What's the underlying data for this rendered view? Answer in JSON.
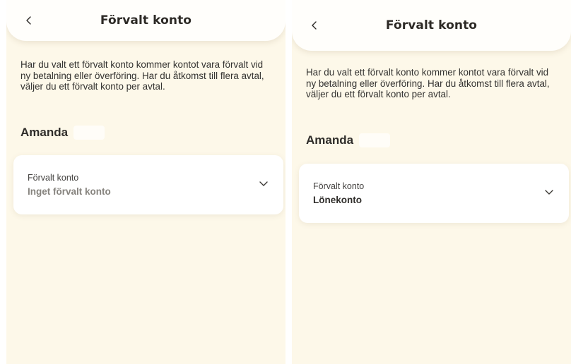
{
  "screens": [
    {
      "header": {
        "title": "Förvalt konto"
      },
      "description": "Har du valt ett förvalt konto kommer kontot vara förvalt vid ny betalning eller överföring. Har du åtkomst till flera avtal, väljer du ett förvalt konto per avtal.",
      "owner": {
        "name": "Amanda"
      },
      "account_select": {
        "label": "Förvalt konto",
        "value": "Inget förvalt konto"
      }
    },
    {
      "header": {
        "title": "Förvalt konto"
      },
      "description": "Har du valt ett förvalt konto kommer kontot vara förvalt vid ny betalning eller överföring. Har du åtkomst till flera avtal, väljer du ett förvalt konto per avtal.",
      "owner": {
        "name": "Amanda"
      },
      "account_select": {
        "label": "Förvalt konto",
        "value": "Lönekonto"
      }
    }
  ],
  "icons": {
    "back": "chevron-left-icon",
    "dropdown": "chevron-down-icon"
  },
  "colors": {
    "background": "#fdf8e9",
    "card": "#ffffff",
    "text": "#333333",
    "muted": "#86837e"
  }
}
